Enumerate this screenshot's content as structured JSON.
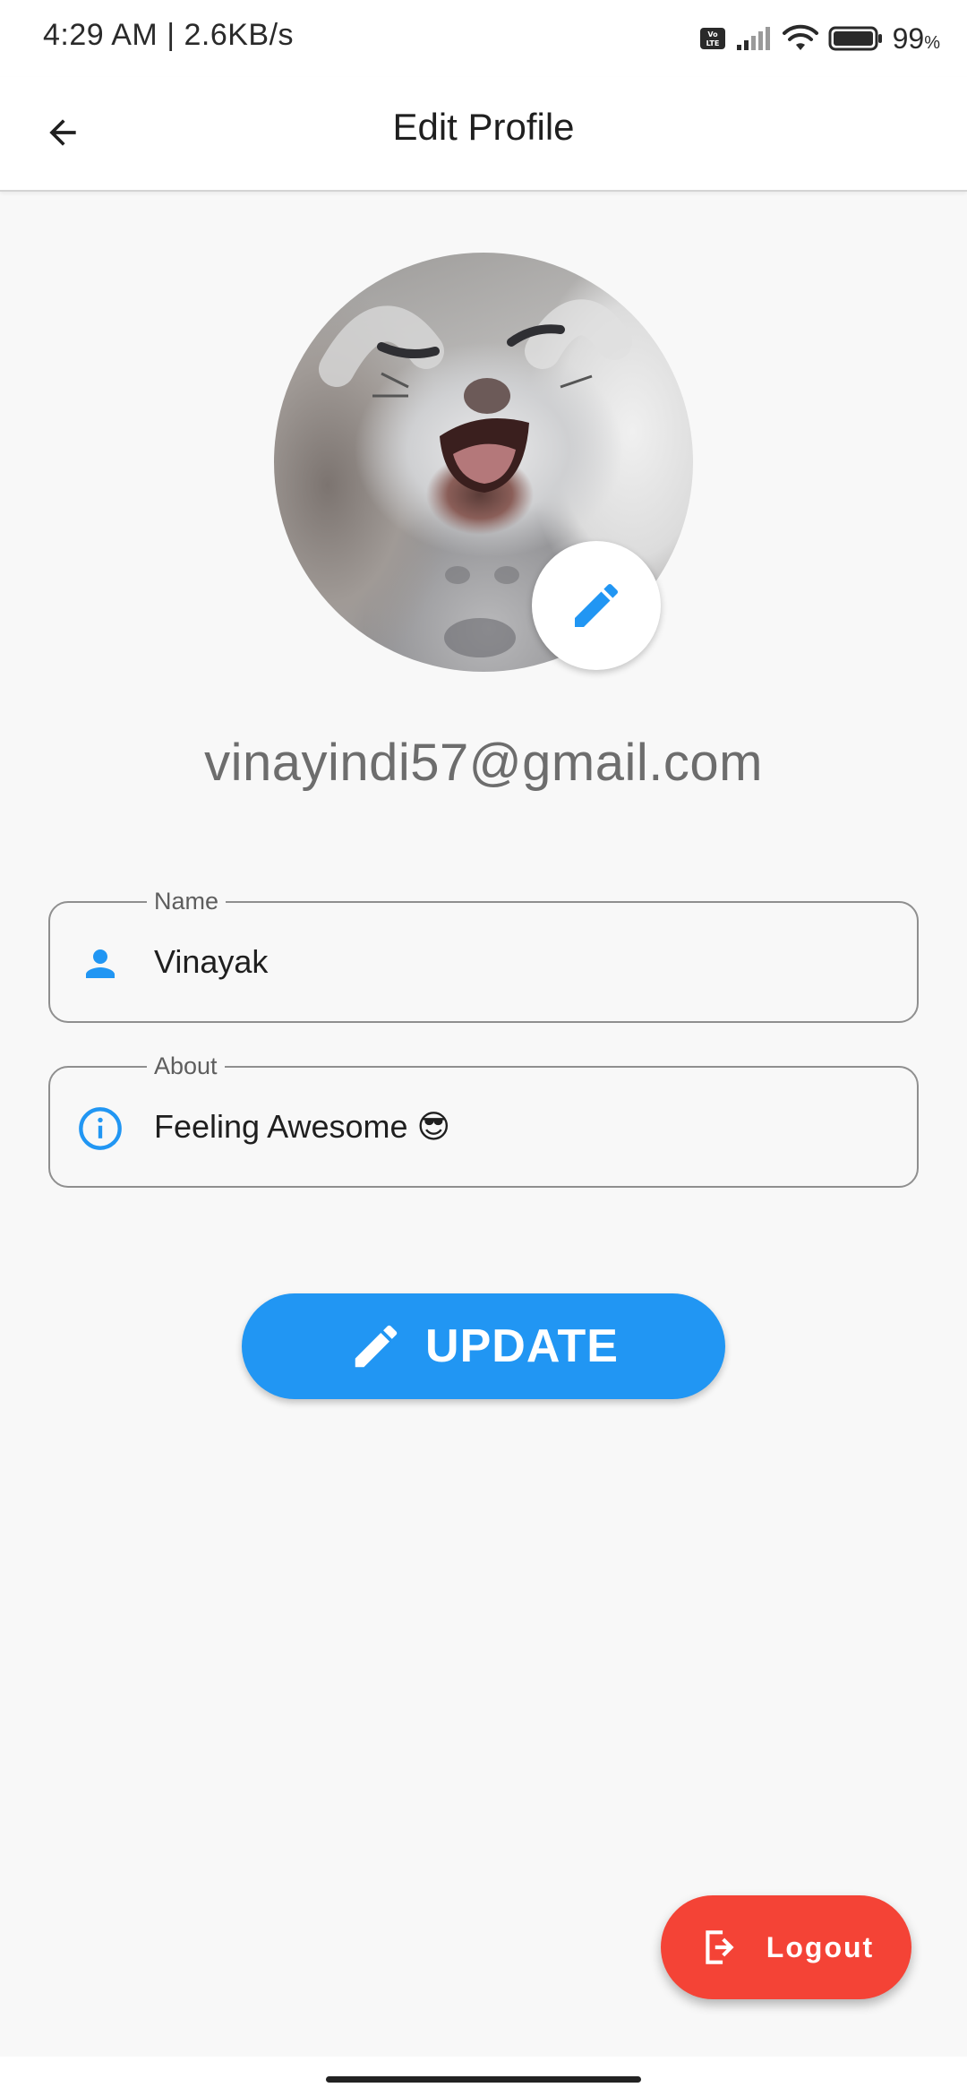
{
  "status_bar": {
    "time_text": "4:29 AM | 2.6KB/s",
    "battery_level": "99",
    "battery_unit": "%",
    "icons": [
      "volte-icon",
      "signal-icon",
      "wifi-icon",
      "battery-icon"
    ]
  },
  "app_bar": {
    "title": "Edit Profile",
    "back_icon": "arrow-back-icon"
  },
  "profile": {
    "avatar": "profile-photo",
    "edit_icon": "pencil-icon",
    "email": "vinayindi57@gmail.com"
  },
  "form": {
    "name": {
      "label": "Name",
      "value": "Vinayak",
      "icon": "person-icon"
    },
    "about": {
      "label": "About",
      "value": "Feeling Awesome 😎",
      "icon": "info-icon"
    }
  },
  "update_button": {
    "label": "UPDATE",
    "icon": "pencil-icon"
  },
  "logout_button": {
    "label": "Logout",
    "icon": "logout-icon"
  },
  "colors": {
    "primary": "#2196f3",
    "danger": "#f44336",
    "background": "#f8f8f8",
    "appbar": "#ffffff"
  }
}
